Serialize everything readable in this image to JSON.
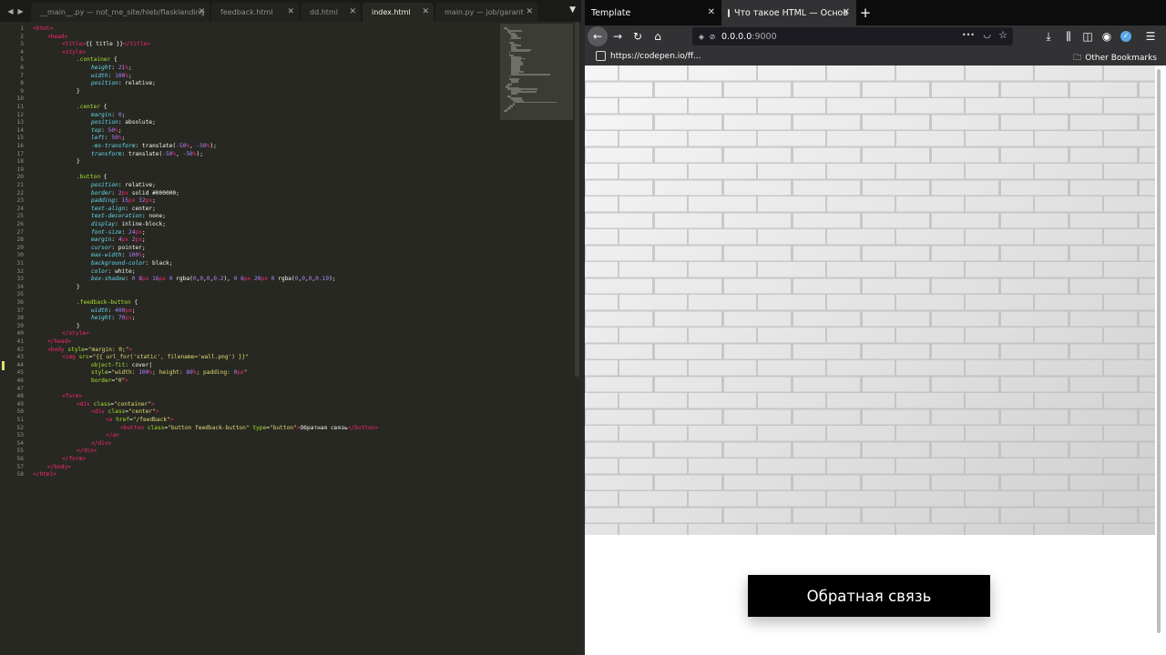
{
  "editor": {
    "tabs": [
      {
        "label": "__main__.py — not_me_site/hleb/flasklanding",
        "active": false
      },
      {
        "label": "feedback.html",
        "active": false
      },
      {
        "label": "dd.html",
        "active": false
      },
      {
        "label": "index.html",
        "active": true
      },
      {
        "label": "main.py — job/garant",
        "active": false
      }
    ],
    "theme_colors": {
      "background": "#272822",
      "tag": "#f92672",
      "attr": "#a6e22e",
      "string": "#e6db74",
      "number": "#ae81ff",
      "property": "#66d9ef"
    },
    "code_lines": [
      {
        "n": "1",
        "indent": 0,
        "parts": [
          [
            "tg",
            "<html>"
          ]
        ]
      },
      {
        "n": "2",
        "indent": 1,
        "parts": [
          [
            "tg",
            "<head>"
          ]
        ]
      },
      {
        "n": "3",
        "indent": 2,
        "parts": [
          [
            "tg",
            "<title>"
          ],
          [
            "tx",
            "{{ title }}"
          ],
          [
            "tg",
            "</title>"
          ]
        ]
      },
      {
        "n": "4",
        "indent": 2,
        "parts": [
          [
            "tg",
            "<style>"
          ]
        ]
      },
      {
        "n": "5",
        "indent": 3,
        "parts": [
          [
            "sel",
            ".container"
          ],
          [
            "tx",
            " {"
          ]
        ]
      },
      {
        "n": "6",
        "indent": 4,
        "parts": [
          [
            "pr",
            "height"
          ],
          [
            "tx",
            ": "
          ],
          [
            "nm",
            "21"
          ],
          [
            "un",
            "%"
          ],
          [
            "tx",
            ";"
          ]
        ]
      },
      {
        "n": "7",
        "indent": 4,
        "parts": [
          [
            "pr",
            "width"
          ],
          [
            "tx",
            ": "
          ],
          [
            "nm",
            "100"
          ],
          [
            "un",
            "%"
          ],
          [
            "tx",
            ";"
          ]
        ]
      },
      {
        "n": "8",
        "indent": 4,
        "parts": [
          [
            "pr",
            "position"
          ],
          [
            "tx",
            ": relative;"
          ]
        ]
      },
      {
        "n": "9",
        "indent": 3,
        "parts": [
          [
            "tx",
            "}"
          ]
        ]
      },
      {
        "n": "10",
        "indent": 0,
        "parts": []
      },
      {
        "n": "11",
        "indent": 3,
        "parts": [
          [
            "sel",
            ".center"
          ],
          [
            "tx",
            " {"
          ]
        ]
      },
      {
        "n": "12",
        "indent": 4,
        "parts": [
          [
            "pr",
            "margin"
          ],
          [
            "tx",
            ": "
          ],
          [
            "nm",
            "0"
          ],
          [
            "tx",
            ";"
          ]
        ]
      },
      {
        "n": "13",
        "indent": 4,
        "parts": [
          [
            "pr",
            "position"
          ],
          [
            "tx",
            ": absolute;"
          ]
        ]
      },
      {
        "n": "14",
        "indent": 4,
        "parts": [
          [
            "pr",
            "top"
          ],
          [
            "tx",
            ": "
          ],
          [
            "nm",
            "50"
          ],
          [
            "un",
            "%"
          ],
          [
            "tx",
            ";"
          ]
        ]
      },
      {
        "n": "15",
        "indent": 4,
        "parts": [
          [
            "pr",
            "left"
          ],
          [
            "tx",
            ": "
          ],
          [
            "nm",
            "50"
          ],
          [
            "un",
            "%"
          ],
          [
            "tx",
            ";"
          ]
        ]
      },
      {
        "n": "16",
        "indent": 4,
        "parts": [
          [
            "pr",
            "-ms-transform"
          ],
          [
            "tx",
            ": translate("
          ],
          [
            "nm",
            "-50"
          ],
          [
            "un",
            "%"
          ],
          [
            "tx",
            ", "
          ],
          [
            "nm",
            "-50"
          ],
          [
            "un",
            "%"
          ],
          [
            "tx",
            ");"
          ]
        ]
      },
      {
        "n": "17",
        "indent": 4,
        "parts": [
          [
            "pr",
            "transform"
          ],
          [
            "tx",
            ": translate("
          ],
          [
            "nm",
            "-50"
          ],
          [
            "un",
            "%"
          ],
          [
            "tx",
            ", "
          ],
          [
            "nm",
            "-50"
          ],
          [
            "un",
            "%"
          ],
          [
            "tx",
            ");"
          ]
        ]
      },
      {
        "n": "18",
        "indent": 3,
        "parts": [
          [
            "tx",
            "}"
          ]
        ]
      },
      {
        "n": "19",
        "indent": 0,
        "parts": []
      },
      {
        "n": "20",
        "indent": 3,
        "parts": [
          [
            "sel",
            ".button"
          ],
          [
            "tx",
            " {"
          ]
        ]
      },
      {
        "n": "21",
        "indent": 4,
        "parts": [
          [
            "pr",
            "position"
          ],
          [
            "tx",
            ": relative;"
          ]
        ]
      },
      {
        "n": "22",
        "indent": 4,
        "parts": [
          [
            "pr",
            "border"
          ],
          [
            "tx",
            ": "
          ],
          [
            "nm",
            "2"
          ],
          [
            "un",
            "px"
          ],
          [
            "tx",
            " solid #000000;"
          ]
        ]
      },
      {
        "n": "23",
        "indent": 4,
        "parts": [
          [
            "pr",
            "padding"
          ],
          [
            "tx",
            ": "
          ],
          [
            "nm",
            "15"
          ],
          [
            "un",
            "px"
          ],
          [
            "tx",
            " "
          ],
          [
            "nm",
            "32"
          ],
          [
            "un",
            "px"
          ],
          [
            "tx",
            ";"
          ]
        ]
      },
      {
        "n": "24",
        "indent": 4,
        "parts": [
          [
            "pr",
            "text-align"
          ],
          [
            "tx",
            ": center;"
          ]
        ]
      },
      {
        "n": "25",
        "indent": 4,
        "parts": [
          [
            "pr",
            "text-decoration"
          ],
          [
            "tx",
            ": none;"
          ]
        ]
      },
      {
        "n": "26",
        "indent": 4,
        "parts": [
          [
            "pr",
            "display"
          ],
          [
            "tx",
            ": inline-block;"
          ]
        ]
      },
      {
        "n": "27",
        "indent": 4,
        "parts": [
          [
            "pr",
            "font-size"
          ],
          [
            "tx",
            ": "
          ],
          [
            "nm",
            "24"
          ],
          [
            "un",
            "px"
          ],
          [
            "tx",
            ";"
          ]
        ]
      },
      {
        "n": "28",
        "indent": 4,
        "parts": [
          [
            "pr",
            "margin"
          ],
          [
            "tx",
            ": "
          ],
          [
            "nm",
            "4"
          ],
          [
            "un",
            "px"
          ],
          [
            "tx",
            " "
          ],
          [
            "nm",
            "2"
          ],
          [
            "un",
            "px"
          ],
          [
            "tx",
            ";"
          ]
        ]
      },
      {
        "n": "29",
        "indent": 4,
        "parts": [
          [
            "pr",
            "cursor"
          ],
          [
            "tx",
            ": pointer;"
          ]
        ]
      },
      {
        "n": "30",
        "indent": 4,
        "parts": [
          [
            "pr",
            "max-width"
          ],
          [
            "tx",
            ": "
          ],
          [
            "nm",
            "100"
          ],
          [
            "un",
            "%"
          ],
          [
            "tx",
            ";"
          ]
        ]
      },
      {
        "n": "31",
        "indent": 4,
        "parts": [
          [
            "pr",
            "background-color"
          ],
          [
            "tx",
            ": black;"
          ]
        ]
      },
      {
        "n": "32",
        "indent": 4,
        "parts": [
          [
            "pr",
            "color"
          ],
          [
            "tx",
            ": white;"
          ]
        ]
      },
      {
        "n": "33",
        "indent": 4,
        "parts": [
          [
            "pr",
            "box-shadow"
          ],
          [
            "tx",
            ": "
          ],
          [
            "nm",
            "0"
          ],
          [
            "tx",
            " "
          ],
          [
            "nm",
            "8"
          ],
          [
            "un",
            "px"
          ],
          [
            "tx",
            " "
          ],
          [
            "nm",
            "16"
          ],
          [
            "un",
            "px"
          ],
          [
            "tx",
            " "
          ],
          [
            "nm",
            "0"
          ],
          [
            "tx",
            " rgba("
          ],
          [
            "nm",
            "0"
          ],
          [
            "tx",
            ","
          ],
          [
            "nm",
            "0"
          ],
          [
            "tx",
            ","
          ],
          [
            "nm",
            "0"
          ],
          [
            "tx",
            ","
          ],
          [
            "nm",
            "0.2"
          ],
          [
            "tx",
            "), "
          ],
          [
            "nm",
            "0"
          ],
          [
            "tx",
            " "
          ],
          [
            "nm",
            "6"
          ],
          [
            "un",
            "px"
          ],
          [
            "tx",
            " "
          ],
          [
            "nm",
            "20"
          ],
          [
            "un",
            "px"
          ],
          [
            "tx",
            " "
          ],
          [
            "nm",
            "0"
          ],
          [
            "tx",
            " rgba("
          ],
          [
            "nm",
            "0"
          ],
          [
            "tx",
            ","
          ],
          [
            "nm",
            "0"
          ],
          [
            "tx",
            ","
          ],
          [
            "nm",
            "0"
          ],
          [
            "tx",
            ","
          ],
          [
            "nm",
            "0.19"
          ],
          [
            "tx",
            ");"
          ]
        ]
      },
      {
        "n": "34",
        "indent": 3,
        "parts": [
          [
            "tx",
            "}"
          ]
        ]
      },
      {
        "n": "35",
        "indent": 0,
        "parts": []
      },
      {
        "n": "36",
        "indent": 3,
        "parts": [
          [
            "sel",
            ".feedback-button"
          ],
          [
            "tx",
            " {"
          ]
        ]
      },
      {
        "n": "37",
        "indent": 4,
        "parts": [
          [
            "pr",
            "width"
          ],
          [
            "tx",
            ": "
          ],
          [
            "nm",
            "400"
          ],
          [
            "un",
            "px"
          ],
          [
            "tx",
            ";"
          ]
        ]
      },
      {
        "n": "38",
        "indent": 4,
        "parts": [
          [
            "pr",
            "height"
          ],
          [
            "tx",
            ": "
          ],
          [
            "nm",
            "70"
          ],
          [
            "un",
            "px"
          ],
          [
            "tx",
            ";"
          ]
        ]
      },
      {
        "n": "39",
        "indent": 3,
        "parts": [
          [
            "tx",
            "}"
          ]
        ]
      },
      {
        "n": "40",
        "indent": 2,
        "parts": [
          [
            "tg",
            "</style>"
          ]
        ]
      },
      {
        "n": "41",
        "indent": 1,
        "parts": [
          [
            "tg",
            "</head>"
          ]
        ]
      },
      {
        "n": "42",
        "indent": 1,
        "parts": [
          [
            "tg",
            "<body"
          ],
          [
            "tx",
            " "
          ],
          [
            "at",
            "style"
          ],
          [
            "tx",
            "="
          ],
          [
            "st",
            "\"margin: 0;\""
          ],
          [
            "tg",
            ">"
          ]
        ]
      },
      {
        "n": "43",
        "indent": 2,
        "parts": [
          [
            "tg",
            "<img"
          ],
          [
            "tx",
            " "
          ],
          [
            "at",
            "src"
          ],
          [
            "tx",
            "="
          ],
          [
            "st",
            "\"{{ url_for('static', filename='wall.png') }}\""
          ]
        ]
      },
      {
        "n": "44",
        "indent": 4,
        "parts": [
          [
            "at",
            "object-fit"
          ],
          [
            "tx",
            ": cover|"
          ]
        ]
      },
      {
        "n": "45",
        "indent": 4,
        "parts": [
          [
            "at",
            "style"
          ],
          [
            "tx",
            "="
          ],
          [
            "st",
            "\"width: "
          ],
          [
            "nm",
            "100"
          ],
          [
            "un",
            "%"
          ],
          [
            "st",
            "; height: "
          ],
          [
            "nm",
            "80"
          ],
          [
            "un",
            "%"
          ],
          [
            "st",
            "; padding: "
          ],
          [
            "nm",
            "0"
          ],
          [
            "un",
            "px"
          ],
          [
            "st",
            "\""
          ]
        ]
      },
      {
        "n": "46",
        "indent": 4,
        "parts": [
          [
            "at",
            "border"
          ],
          [
            "tx",
            "="
          ],
          [
            "st",
            "\"0\""
          ],
          [
            "tg",
            ">"
          ]
        ]
      },
      {
        "n": "47",
        "indent": 0,
        "parts": []
      },
      {
        "n": "48",
        "indent": 2,
        "parts": [
          [
            "tg",
            "<form>"
          ]
        ]
      },
      {
        "n": "49",
        "indent": 3,
        "parts": [
          [
            "tg",
            "<div"
          ],
          [
            "tx",
            " "
          ],
          [
            "at",
            "class"
          ],
          [
            "tx",
            "="
          ],
          [
            "st",
            "\"container\""
          ],
          [
            "tg",
            ">"
          ]
        ]
      },
      {
        "n": "50",
        "indent": 4,
        "parts": [
          [
            "tg",
            "<div"
          ],
          [
            "tx",
            " "
          ],
          [
            "at",
            "class"
          ],
          [
            "tx",
            "="
          ],
          [
            "st",
            "\"center\""
          ],
          [
            "tg",
            ">"
          ]
        ]
      },
      {
        "n": "51",
        "indent": 5,
        "parts": [
          [
            "tg",
            "<a"
          ],
          [
            "tx",
            " "
          ],
          [
            "at",
            "href"
          ],
          [
            "tx",
            "="
          ],
          [
            "st",
            "\"/feedback\""
          ],
          [
            "tg",
            ">"
          ]
        ]
      },
      {
        "n": "52",
        "indent": 6,
        "parts": [
          [
            "tg",
            "<button"
          ],
          [
            "tx",
            " "
          ],
          [
            "at",
            "class"
          ],
          [
            "tx",
            "="
          ],
          [
            "st",
            "\"button feedback-button\""
          ],
          [
            "tx",
            " "
          ],
          [
            "at",
            "type"
          ],
          [
            "tx",
            "="
          ],
          [
            "st",
            "\"button\""
          ],
          [
            "tg",
            ">"
          ],
          [
            "tx",
            "Обратная связь"
          ],
          [
            "tg",
            "</button>"
          ]
        ]
      },
      {
        "n": "53",
        "indent": 5,
        "parts": [
          [
            "tg",
            "</a>"
          ]
        ]
      },
      {
        "n": "54",
        "indent": 4,
        "parts": [
          [
            "tg",
            "</div>"
          ]
        ]
      },
      {
        "n": "55",
        "indent": 3,
        "parts": [
          [
            "tg",
            "</div>"
          ]
        ]
      },
      {
        "n": "56",
        "indent": 2,
        "parts": [
          [
            "tg",
            "</form>"
          ]
        ]
      },
      {
        "n": "57",
        "indent": 1,
        "parts": [
          [
            "tg",
            "</body>"
          ]
        ]
      },
      {
        "n": "58",
        "indent": 0,
        "parts": [
          [
            "tg",
            "</html>"
          ]
        ]
      }
    ]
  },
  "browser": {
    "tabs": [
      {
        "label": "Template",
        "active": false
      },
      {
        "label": "Что такое HTML — Основ",
        "active": true
      }
    ],
    "new_tab_symbol": "+",
    "url_host": "0.0.0.0",
    "url_port": ":9000",
    "url_dots": "•••",
    "bookmark_label": "https://codepen.io/ff...",
    "other_bookmarks_label": "Other Bookmarks",
    "feedback_button_label": "Обратная связь",
    "wall_color": "#e2e2e2"
  }
}
